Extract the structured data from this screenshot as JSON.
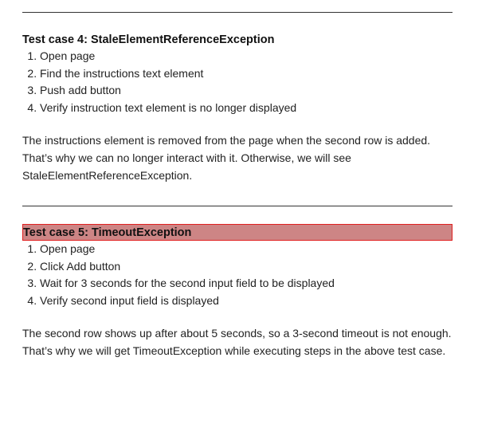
{
  "section4": {
    "heading": "Test case 4: StaleElementReferenceException",
    "steps": [
      "Open page",
      "Find the instructions text element",
      "Push add button",
      "Verify instruction text element is no longer displayed"
    ],
    "explanation": "The instructions element is removed from the page when the second row is added. That’s why we can no longer interact with it. Otherwise, we will see StaleElementReferenceException."
  },
  "section5": {
    "heading": "Test case 5: TimeoutException",
    "highlight_color": "#cd8585",
    "highlight_border": "#e02020",
    "steps": [
      "Open page",
      "Click Add button",
      "Wait for 3 seconds for the second input field to be displayed",
      "Verify second input field is displayed"
    ],
    "explanation": "The second row shows up after about 5 seconds, so a 3-second timeout is not enough. That’s why we will get TimeoutException while executing steps in the above test case."
  }
}
